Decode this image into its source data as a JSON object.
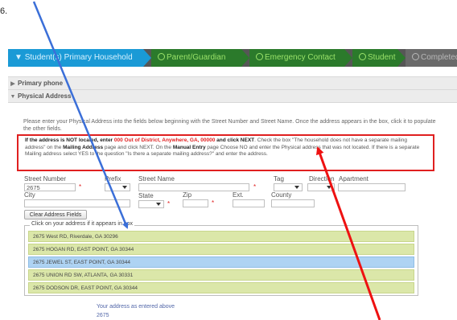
{
  "corner_label": "6.",
  "steps": [
    {
      "label": "Student(s) Primary Household"
    },
    {
      "label": "Parent/Guardian"
    },
    {
      "label": "Emergency Contact"
    },
    {
      "label": "Student"
    },
    {
      "label": "Completed"
    }
  ],
  "sections": {
    "primary_phone": "Primary phone",
    "physical_address": "Physical Address"
  },
  "instructions": "Please enter your Physical Address into the fields below beginning with the Street Number and Street Name. Once the address appears in the box, click it to populate the other fields.",
  "notice": {
    "p1": "If the address is NOT located, enter ",
    "p2": "000 Out of District, Anywhere, GA, 00000",
    "p3": " and click NEXT",
    "p4": ". Check the box \"The household does not have a separate mailing address\" on the ",
    "p5": "Mailing Address",
    "p6": " page and click NEXT. On the ",
    "p7": "Manual Entry",
    "p8": " page Choose NO and enter the Physical address that was not located. If there is a separate Mailing address select YES to the question \"Is there a separate mailing address?\" and enter the address."
  },
  "form": {
    "street_number_label": "Street Number",
    "street_number_value": "2675",
    "prefix_label": "Prefix",
    "street_name_label": "Street Name",
    "tag_label": "Tag",
    "direction_label": "Direction",
    "apartment_label": "Apartment",
    "city_label": "City",
    "state_label": "State",
    "zip_label": "Zip",
    "ext_label": "Ext.",
    "county_label": "County",
    "required_mark": "*"
  },
  "clear_button": "Clear Address Fields",
  "address_box": {
    "legend": "Click on your address if it appears in box",
    "items": [
      "2675 West RD, Riverdale, GA 30296",
      "2675 HOGAN RD, EAST POINT, GA 30344",
      "2675 JEWEL ST, EAST POINT, GA 30344",
      "2675 UNION RD SW, ATLANTA, GA 30331",
      "2675 DODSON DR, EAST POINT, GA 30344"
    ],
    "selected_index": 2
  },
  "entered": {
    "label": "Your address as entered above",
    "value": "2675"
  },
  "colors": {
    "annotation_blue": "#3b6fd8",
    "annotation_red": "#ee1111",
    "notice_border": "#e02020"
  }
}
